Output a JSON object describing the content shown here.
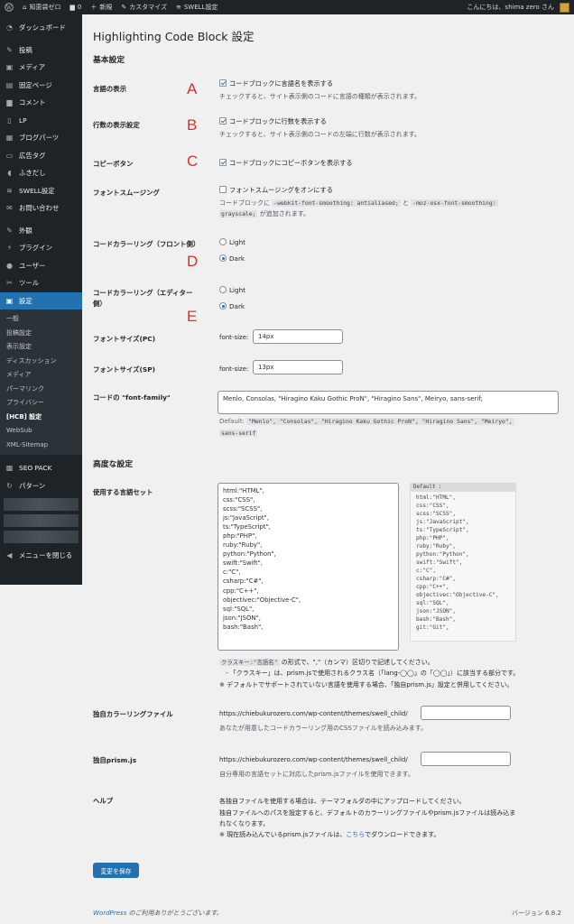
{
  "adminbar": {
    "site_name": "知恵袋ゼロ",
    "comments_count": "0",
    "new_label": "新規",
    "customize_label": "カスタマイズ",
    "swell_label": "SWELL設定",
    "greeting": "こんにちは、shima zero さん"
  },
  "sidebar": {
    "items": [
      {
        "label": "ダッシュボード",
        "icon": "dashboard-icon"
      },
      {
        "label": "投稿",
        "icon": "pin-icon"
      },
      {
        "label": "メディア",
        "icon": "media-icon"
      },
      {
        "label": "固定ページ",
        "icon": "page-icon"
      },
      {
        "label": "コメント",
        "icon": "comment-icon"
      },
      {
        "label": "LP",
        "icon": "document-icon"
      },
      {
        "label": "ブログパーツ",
        "icon": "grid-icon"
      },
      {
        "label": "広告タグ",
        "icon": "ad-icon"
      },
      {
        "label": "ふきだし",
        "icon": "bubble-icon"
      },
      {
        "label": "SWELL設定",
        "icon": "swell-icon"
      },
      {
        "label": "お問い合わせ",
        "icon": "mail-icon"
      },
      {
        "label": "外観",
        "icon": "brush-icon"
      },
      {
        "label": "プラグイン",
        "icon": "plugin-icon"
      },
      {
        "label": "ユーザー",
        "icon": "user-icon"
      },
      {
        "label": "ツール",
        "icon": "wrench-icon"
      },
      {
        "label": "設定",
        "icon": "settings-icon"
      }
    ],
    "submenu": [
      "一般",
      "投稿設定",
      "表示設定",
      "ディスカッション",
      "メディア",
      "パーマリンク",
      "プライバシー",
      "[HCB] 設定",
      "WebSub",
      "XML-Sitemap"
    ],
    "seo_pack": "SEO PACK",
    "pattern": "パターン",
    "collapse": "メニューを閉じる"
  },
  "page": {
    "title": "Highlighting Code Block 設定",
    "basic_heading": "基本設定",
    "advanced_heading": "高度な設定"
  },
  "annotations": {
    "a": "A",
    "b": "B",
    "c": "C",
    "d": "D",
    "e": "E"
  },
  "settings": {
    "lang_display": {
      "label": "言語の表示",
      "checkbox": "コードブロックに言語名を表示する",
      "checked": true,
      "desc": "チェックすると、サイト表示側のコードに言語の種類が表示されます。"
    },
    "line_numbers": {
      "label": "行数の表示設定",
      "checkbox": "コードブロックに行数を表示する",
      "checked": true,
      "desc": "チェックすると、サイト表示側のコードの左端に行数が表示されます。"
    },
    "copy_button": {
      "label": "コピーボタン",
      "checkbox": "コードブロックにコピーボタンを表示する",
      "checked": true
    },
    "font_smoothing": {
      "label": "フォントスムージング",
      "checkbox": "フォントスムージングをオンにする",
      "checked": false,
      "desc_pre": "コードブロックに",
      "code1": "-webkit-font-smoothing: antialiased;",
      "desc_mid": "と",
      "code2": "-moz-osx-font-smoothing:",
      "code3": "grayscale;",
      "desc_post": "が追加されます。"
    },
    "front_coloring": {
      "label": "コードカラーリング（フロント側）",
      "options": [
        "Light",
        "Dark"
      ],
      "selected": "Dark"
    },
    "editor_coloring": {
      "label_line1": "コードカラーリング（エディター",
      "label_line2": "側）",
      "options": [
        "Light",
        "Dark"
      ],
      "selected": "Dark"
    },
    "font_size_pc": {
      "label": "フォントサイズ(PC)",
      "prefix": "font-size:",
      "value": "14px"
    },
    "font_size_sp": {
      "label": "フォントサイズ(SP)",
      "prefix": "font-size:",
      "value": "13px"
    },
    "font_family": {
      "label": "コードの \"font-family\"",
      "value": "Menlo, Consolas, \"Hiragino Kaku Gothic ProN\", \"Hiragino Sans\", Meiryo, sans-serif;",
      "default_label": "Default:",
      "default_value_1": "\"Menlo\", \"Consolas\", \"Hiragino Kaku Gothic ProN\", \"Hiragino Sans\", \"Meiryo\",",
      "default_value_2": "sans-serif"
    },
    "lang_set": {
      "label": "使用する言語セット",
      "lines": [
        "html:\"HTML\",",
        "css:\"CSS\",",
        "scss:\"SCSS\",",
        "js:\"JavaScript\",",
        "ts:\"TypeScript\",",
        "php:\"PHP\",",
        "ruby:\"Ruby\",",
        "python:\"Python\",",
        "swift:\"Swift\",",
        "c:\"C\",",
        "csharp:\"C#\",",
        "cpp:\"C++\",",
        "objectivec:\"Objective-C\",",
        "sql:\"SQL\",",
        "json:\"JSON\",",
        "bash:\"Bash\","
      ],
      "default_header": "Default :",
      "default_lines": [
        "html:\"HTML\",",
        "css:\"CSS\",",
        "scss:\"SCSS\",",
        "js:\"JavaScript\",",
        "ts:\"TypeScript\",",
        "php:\"PHP\",",
        "ruby:\"Ruby\",",
        "python:\"Python\",",
        "swift:\"Swift\",",
        "c:\"C\",",
        "csharp:\"C#\",",
        "cpp:\"C++\",",
        "objectivec:\"Objective-C\",",
        "sql:\"SQL\",",
        "json:\"JSON\",",
        "bash:\"Bash\",",
        "git:\"Git\","
      ],
      "note_code": "クラスキー:\"言語名\"",
      "note_1": "の形式で、\",\"（カンマ）区切りで記述してください。",
      "note_2": "- 「クラスキー」は、prism.jsで使用されるクラス名（「lang-◯◯」の「◯◯」）に該当する部分です。",
      "note_3": "※ デフォルトでサポートされていない言語を使用する場合、「独自prism.js」設定と併用してください。"
    },
    "custom_coloring": {
      "label": "独自カラーリングファイル",
      "path": "https://chiebukurozero.com/wp-content/themes/swell_child/",
      "value": "",
      "desc": "あなたが用意したコードカラーリング用のCSSファイルを読み込みます。"
    },
    "custom_prism": {
      "label": "独自prism.js",
      "path": "https://chiebukurozero.com/wp-content/themes/swell_child/",
      "value": "",
      "desc": "自分専用の言語セットに対応したprism.jsファイルを使用できます。"
    },
    "help": {
      "label": "ヘルプ",
      "line1": "各独自ファイルを使用する場合は、テーマフォルダの中にアップロードしてください。",
      "line2": "独自ファイルへのパスを設定すると、デフォルトのカラーリングファイルやprism.jsファイルは読み込ま",
      "line3": "れなくなります。",
      "line4_pre": "※ 現在読み込んでいるprism.jsファイルは、",
      "line4_link": "こちら",
      "line4_post": "でダウンロードできます。"
    }
  },
  "save_button": "変更を保存",
  "footer": {
    "link": "WordPress",
    "thanks": "のご利用ありがとうございます。",
    "version": "バージョン 6.8.2"
  }
}
